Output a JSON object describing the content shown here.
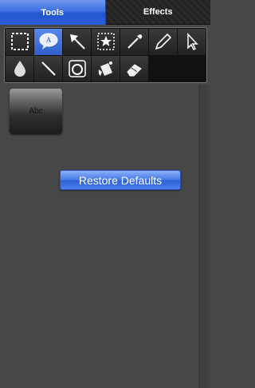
{
  "tabs": [
    {
      "label": "Tools",
      "active": true
    },
    {
      "label": "Effects",
      "active": false
    }
  ],
  "tools": [
    {
      "name": "rectangle-select-icon",
      "selected": false
    },
    {
      "name": "speech-bubble-icon",
      "selected": true,
      "glyph": "A"
    },
    {
      "name": "arrow-icon",
      "selected": false
    },
    {
      "name": "star-stamp-icon",
      "selected": false
    },
    {
      "name": "eyedropper-icon",
      "selected": false
    },
    {
      "name": "pencil-icon",
      "selected": false
    },
    {
      "name": "pointer-icon",
      "selected": false
    },
    {
      "name": "blur-drop-icon",
      "selected": false
    },
    {
      "name": "line-icon",
      "selected": false
    },
    {
      "name": "magnifier-icon",
      "selected": false
    },
    {
      "name": "paint-bucket-icon",
      "selected": false
    },
    {
      "name": "eraser-icon",
      "selected": false
    }
  ],
  "style_swatch": {
    "label": "Abc"
  },
  "restore_button": {
    "label": "Restore Defaults"
  },
  "colors": {
    "accent": "#3b6fe0",
    "background": "#474747"
  }
}
